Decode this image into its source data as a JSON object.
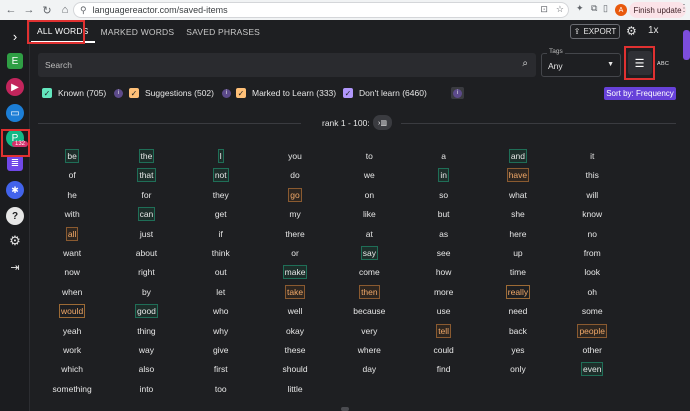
{
  "browser": {
    "url": "languagereactor.com/saved-items",
    "profile_initial": "A",
    "update_label": "Finish update"
  },
  "rail": {
    "items": [
      {
        "name": "expand-chevron-icon",
        "glyph": "›"
      },
      {
        "name": "e-avatar",
        "glyph": "E"
      },
      {
        "name": "play-icon",
        "glyph": "▶"
      },
      {
        "name": "chat-icon",
        "glyph": "▭"
      },
      {
        "name": "p-avatar",
        "glyph": "P"
      },
      {
        "name": "saved-items-icon",
        "glyph": "≣"
      },
      {
        "name": "walker-icon",
        "glyph": "🚶"
      },
      {
        "name": "help-icon",
        "glyph": "?"
      },
      {
        "name": "settings-icon",
        "glyph": "⚙"
      },
      {
        "name": "logout-icon",
        "glyph": "⇥"
      }
    ],
    "badge": "132"
  },
  "tabs": [
    "ALL WORDS",
    "MARKED WORDS",
    "SAVED PHRASES"
  ],
  "toolbar": {
    "export_label": "EXPORT",
    "speed_label": "1x"
  },
  "search": {
    "placeholder": "Search"
  },
  "tags": {
    "label": "Tags",
    "value": "Any"
  },
  "view": {
    "abc_label": "ABC"
  },
  "filters": [
    {
      "label": "Known (705)",
      "color": "#63e6be"
    },
    {
      "label": "Suggestions (502)",
      "color": "#ffc078"
    },
    {
      "label": "Marked to Learn (333)",
      "color": "#ffc078"
    },
    {
      "label": "Don't learn (6460)",
      "color": "#b197fc"
    }
  ],
  "sort_label": "Sort by: Frequency",
  "rank_label": "rank 1 - 100:",
  "words": [
    [
      "be",
      "k"
    ],
    [
      "the",
      "k"
    ],
    [
      "I",
      "k"
    ],
    [
      "you",
      ""
    ],
    [
      "to",
      ""
    ],
    [
      "a",
      ""
    ],
    [
      "and",
      "k"
    ],
    [
      "it",
      ""
    ],
    [
      "of",
      ""
    ],
    [
      "that",
      "k"
    ],
    [
      "not",
      "k"
    ],
    [
      "do",
      ""
    ],
    [
      "we",
      ""
    ],
    [
      "in",
      "k"
    ],
    [
      "have",
      "s"
    ],
    [
      "this",
      ""
    ],
    [
      "he",
      ""
    ],
    [
      "for",
      ""
    ],
    [
      "they",
      ""
    ],
    [
      "go",
      "s"
    ],
    [
      "on",
      ""
    ],
    [
      "so",
      ""
    ],
    [
      "what",
      ""
    ],
    [
      "will",
      ""
    ],
    [
      "with",
      ""
    ],
    [
      "can",
      "k"
    ],
    [
      "get",
      ""
    ],
    [
      "my",
      ""
    ],
    [
      "like",
      ""
    ],
    [
      "but",
      ""
    ],
    [
      "she",
      ""
    ],
    [
      "know",
      ""
    ],
    [
      "all",
      "s"
    ],
    [
      "just",
      ""
    ],
    [
      "if",
      ""
    ],
    [
      "there",
      ""
    ],
    [
      "at",
      ""
    ],
    [
      "as",
      ""
    ],
    [
      "here",
      ""
    ],
    [
      "no",
      ""
    ],
    [
      "want",
      ""
    ],
    [
      "about",
      ""
    ],
    [
      "think",
      ""
    ],
    [
      "or",
      ""
    ],
    [
      "say",
      "k"
    ],
    [
      "see",
      ""
    ],
    [
      "up",
      ""
    ],
    [
      "from",
      ""
    ],
    [
      "now",
      ""
    ],
    [
      "right",
      ""
    ],
    [
      "out",
      ""
    ],
    [
      "make",
      "k"
    ],
    [
      "come",
      ""
    ],
    [
      "how",
      ""
    ],
    [
      "time",
      ""
    ],
    [
      "look",
      ""
    ],
    [
      "when",
      ""
    ],
    [
      "by",
      ""
    ],
    [
      "let",
      ""
    ],
    [
      "take",
      "s"
    ],
    [
      "then",
      "s"
    ],
    [
      "more",
      ""
    ],
    [
      "really",
      "m"
    ],
    [
      "oh",
      ""
    ],
    [
      "would",
      "m"
    ],
    [
      "good",
      "k"
    ],
    [
      "who",
      ""
    ],
    [
      "well",
      ""
    ],
    [
      "because",
      ""
    ],
    [
      "use",
      ""
    ],
    [
      "need",
      ""
    ],
    [
      "some",
      ""
    ],
    [
      "yeah",
      ""
    ],
    [
      "thing",
      ""
    ],
    [
      "why",
      ""
    ],
    [
      "okay",
      ""
    ],
    [
      "very",
      ""
    ],
    [
      "tell",
      "s"
    ],
    [
      "back",
      ""
    ],
    [
      "people",
      "s"
    ],
    [
      "work",
      ""
    ],
    [
      "way",
      ""
    ],
    [
      "give",
      ""
    ],
    [
      "these",
      ""
    ],
    [
      "where",
      ""
    ],
    [
      "could",
      ""
    ],
    [
      "yes",
      ""
    ],
    [
      "other",
      ""
    ],
    [
      "which",
      ""
    ],
    [
      "also",
      ""
    ],
    [
      "first",
      ""
    ],
    [
      "should",
      ""
    ],
    [
      "day",
      ""
    ],
    [
      "find",
      ""
    ],
    [
      "only",
      ""
    ],
    [
      "even",
      "k"
    ],
    [
      "something",
      ""
    ],
    [
      "into",
      ""
    ],
    [
      "too",
      ""
    ],
    [
      "little",
      ""
    ]
  ]
}
